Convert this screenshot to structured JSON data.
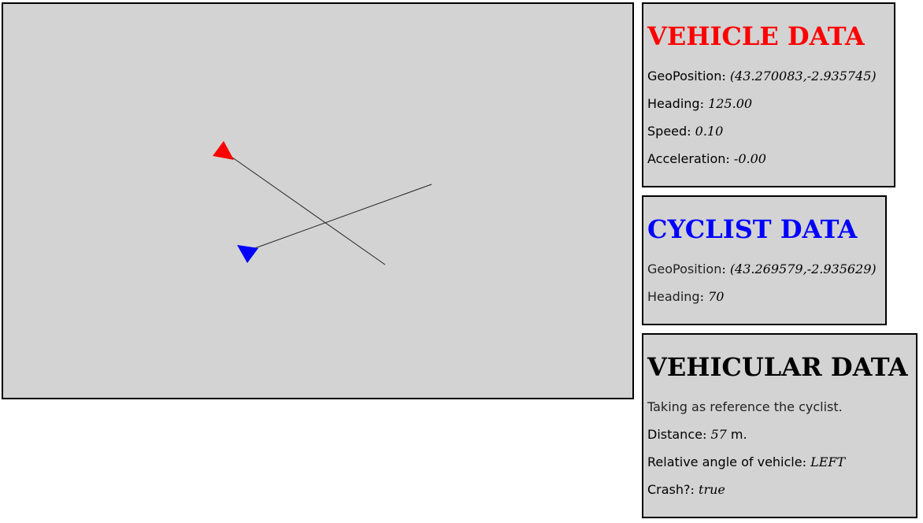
{
  "colors": {
    "panel_bg": "#d3d3d3",
    "vehicle": "#ff0000",
    "cyclist": "#0000ff",
    "vehicular": "#000000"
  },
  "map_canvas": {
    "vehicle_icon": "triangle-marker-icon",
    "cyclist_icon": "triangle-marker-icon"
  },
  "vehicle": {
    "title": "VEHICLE DATA",
    "geoposition_label": "GeoPosition",
    "geoposition_value": "(43.270083,-2.935745)",
    "heading_label": "Heading",
    "heading_value": "125.00",
    "speed_label": "Speed",
    "speed_value": "0.10",
    "acceleration_label": "Acceleration",
    "acceleration_value": "-0.00"
  },
  "cyclist": {
    "title": "CYCLIST DATA",
    "geoposition_label": "GeoPosition",
    "geoposition_value": "(43.269579,-2.935629)",
    "heading_label": "Heading",
    "heading_value": "70"
  },
  "vehicular": {
    "title": "VEHICULAR DATA",
    "note": "Taking as reference the cyclist.",
    "distance_label": "Distance",
    "distance_value": "57",
    "distance_unit": "m.",
    "relative_angle_label": "Relative angle of vehicle",
    "relative_angle_value": "LEFT",
    "crash_label": "Crash?",
    "crash_value": "true"
  }
}
